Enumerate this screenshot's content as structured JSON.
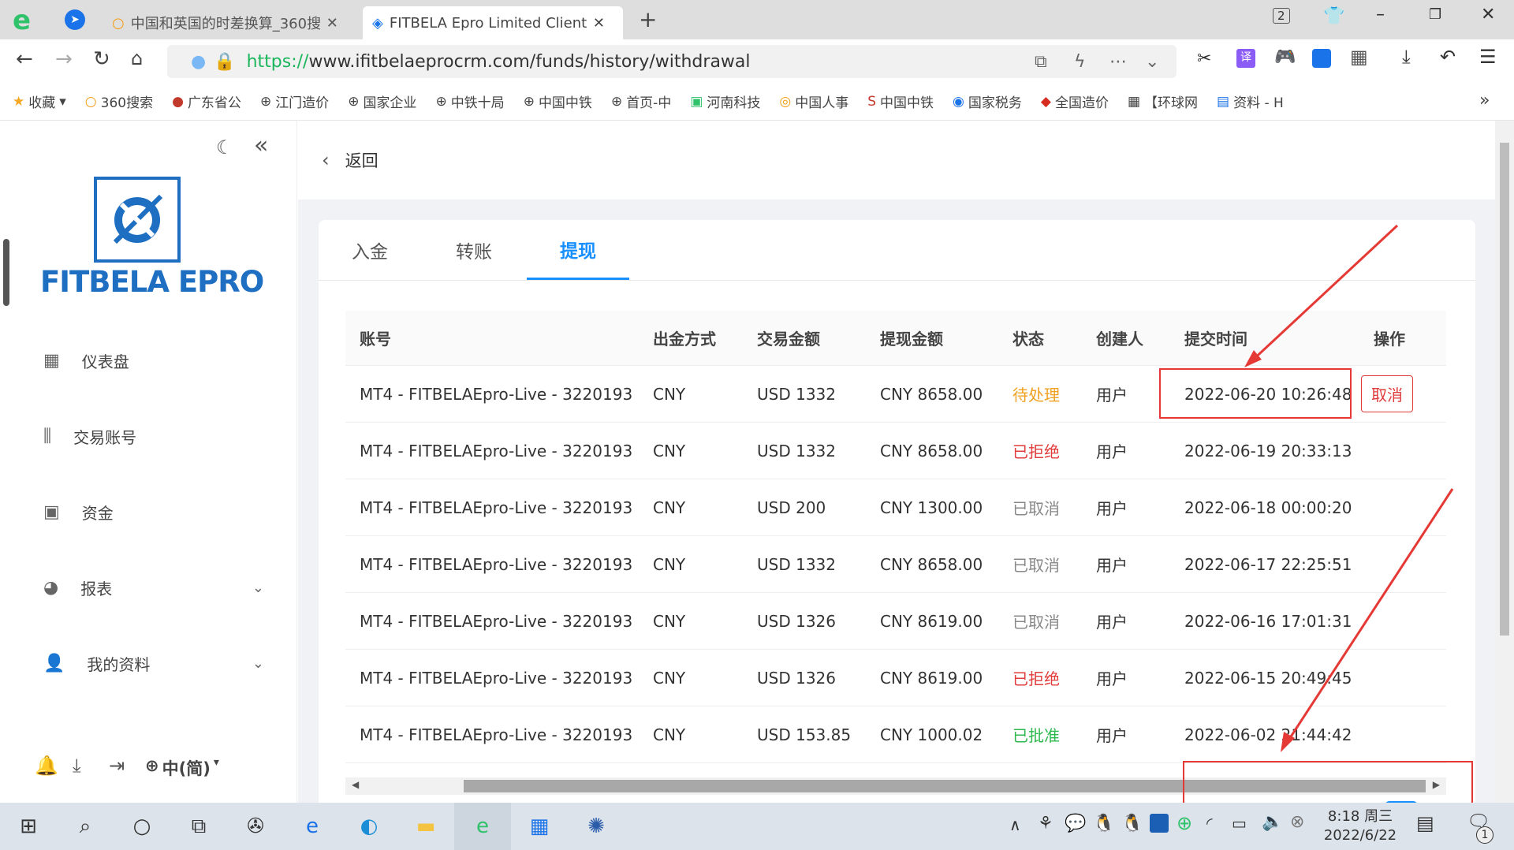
{
  "browser": {
    "tabs": [
      {
        "label": "中国和英国的时差换算_360搜"
      },
      {
        "label": "FITBELA Epro Limited Client"
      }
    ],
    "tab_counter": "2",
    "url_scheme": "https://",
    "url_rest": "www.ifitbelaeprocrm.com/funds/history/withdrawal",
    "bookmarks": [
      "收藏",
      "360搜索",
      "广东省公",
      "江门造价",
      "国家企业",
      "中铁十局",
      "中国中铁",
      "首页-中",
      "河南科技",
      "中国人事",
      "中国中铁",
      "国家税务",
      "全国造价",
      "【环球网",
      "资料 - H"
    ]
  },
  "sidebar": {
    "brand": "FITBELA EPRO",
    "menu": [
      {
        "label": "仪表盘"
      },
      {
        "label": "交易账号"
      },
      {
        "label": "资金"
      },
      {
        "label": "报表"
      },
      {
        "label": "我的资料"
      }
    ],
    "language": "中(简)"
  },
  "header": {
    "back_label": "返回"
  },
  "tabs": [
    {
      "label": "入金"
    },
    {
      "label": "转账"
    },
    {
      "label": "提现"
    }
  ],
  "table": {
    "columns": [
      "账号",
      "出金方式",
      "交易金额",
      "提现金额",
      "状态",
      "创建人",
      "提交时间",
      "操作"
    ],
    "rows": [
      {
        "account": "MT4 - FITBELAEpro-Live - 3220193",
        "method": "CNY",
        "amount": "USD 1332",
        "withdraw": "CNY 8658.00",
        "status": "待处理",
        "status_color": "#f0a020",
        "creator": "用户",
        "time": "2022-06-20 10:26:48",
        "action": "取消"
      },
      {
        "account": "MT4 - FITBELAEpro-Live - 3220193",
        "method": "CNY",
        "amount": "USD 1332",
        "withdraw": "CNY 8658.00",
        "status": "已拒绝",
        "status_color": "#e03c3c",
        "creator": "用户",
        "time": "2022-06-19 20:33:13",
        "action": ""
      },
      {
        "account": "MT4 - FITBELAEpro-Live - 3220193",
        "method": "CNY",
        "amount": "USD 200",
        "withdraw": "CNY 1300.00",
        "status": "已取消",
        "status_color": "#888888",
        "creator": "用户",
        "time": "2022-06-18 00:00:20",
        "action": ""
      },
      {
        "account": "MT4 - FITBELAEpro-Live - 3220193",
        "method": "CNY",
        "amount": "USD 1332",
        "withdraw": "CNY 8658.00",
        "status": "已取消",
        "status_color": "#888888",
        "creator": "用户",
        "time": "2022-06-17 22:25:51",
        "action": ""
      },
      {
        "account": "MT4 - FITBELAEpro-Live - 3220193",
        "method": "CNY",
        "amount": "USD 1326",
        "withdraw": "CNY 8619.00",
        "status": "已取消",
        "status_color": "#888888",
        "creator": "用户",
        "time": "2022-06-16 17:01:31",
        "action": ""
      },
      {
        "account": "MT4 - FITBELAEpro-Live - 3220193",
        "method": "CNY",
        "amount": "USD 1326",
        "withdraw": "CNY 8619.00",
        "status": "已拒绝",
        "status_color": "#e03c3c",
        "creator": "用户",
        "time": "2022-06-15 20:49:45",
        "action": ""
      },
      {
        "account": "MT4 - FITBELAEpro-Live - 3220193",
        "method": "CNY",
        "amount": "USD 153.85",
        "withdraw": "CNY 1000.02",
        "status": "已批准",
        "status_color": "#2db84d",
        "creator": "用户",
        "time": "2022-06-02 21:44:42",
        "action": ""
      }
    ]
  },
  "taskbar": {
    "time": "8:18 周三",
    "date": "2022/6/22",
    "notif_count": "1"
  },
  "colors": {
    "accent": "#1890ff",
    "annotation": "#e53935"
  }
}
